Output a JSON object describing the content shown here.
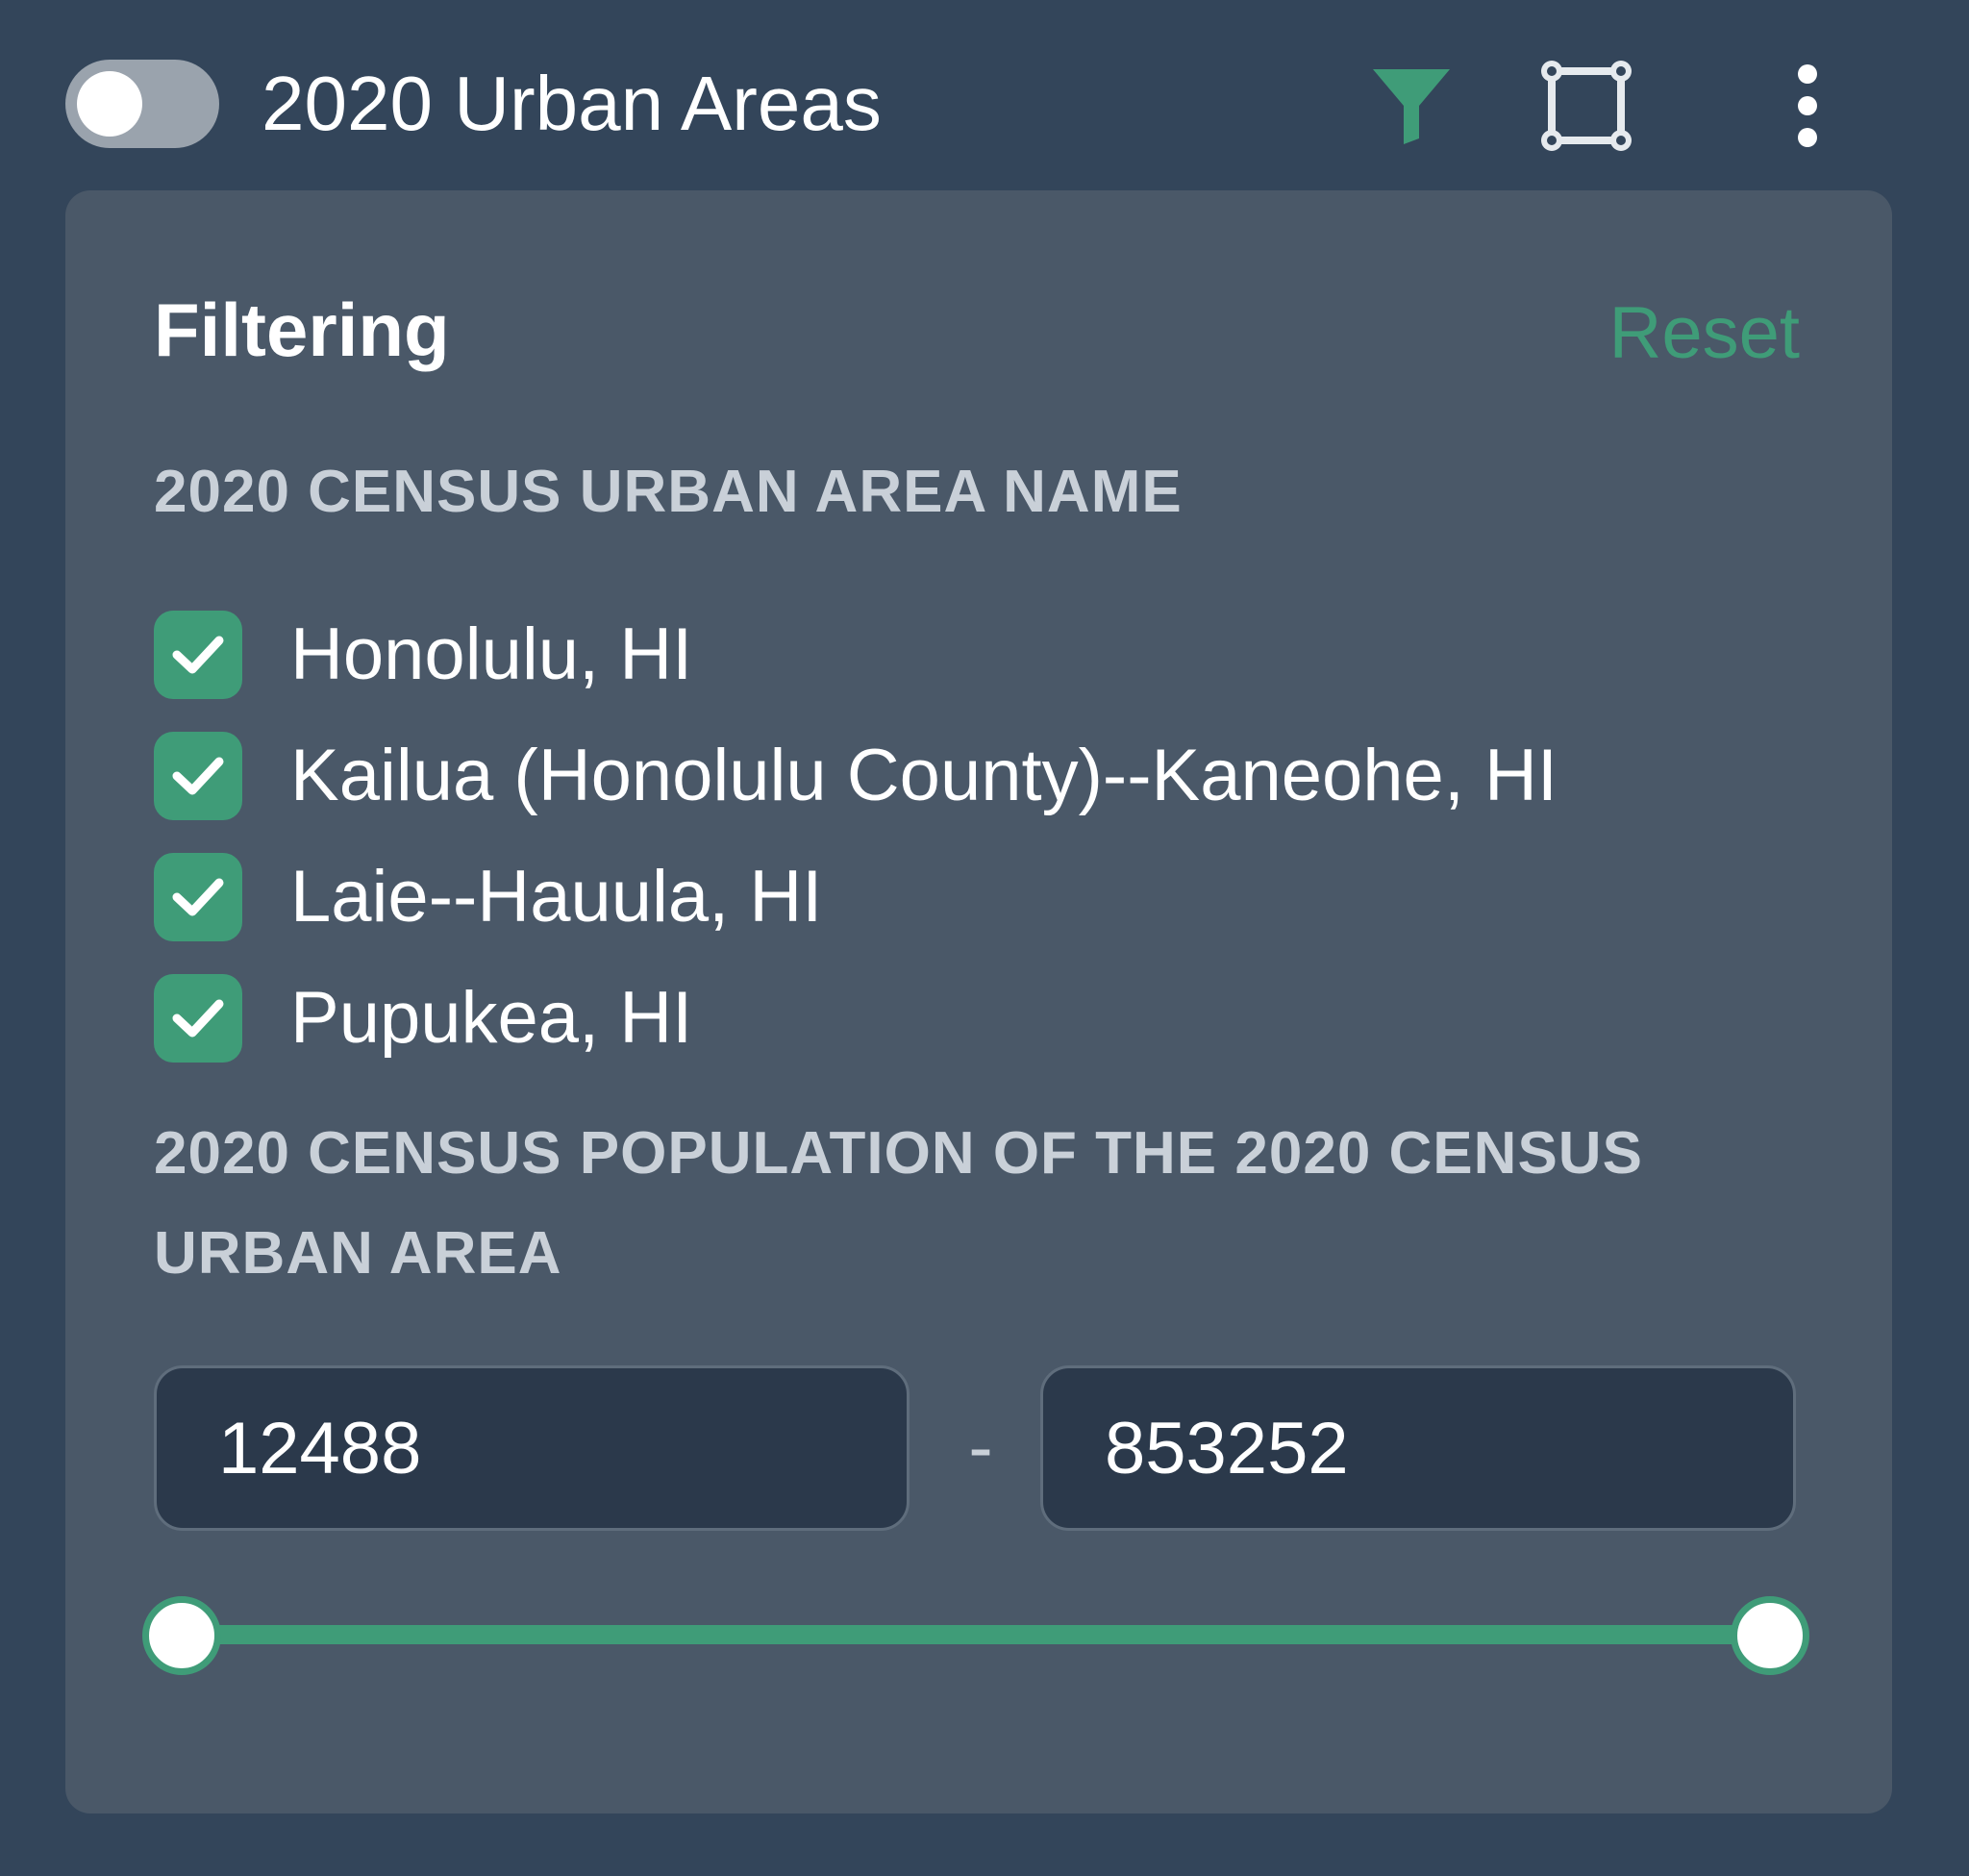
{
  "layer": {
    "title": "2020 Urban Areas",
    "visible": false,
    "icons": {
      "filter": "filter-icon",
      "frame": "frame-select-icon",
      "more": "more-vertical-icon"
    }
  },
  "filtering": {
    "title": "Filtering",
    "reset_label": "Reset",
    "name_section": {
      "label": "2020 CENSUS URBAN AREA NAME",
      "options": [
        {
          "label": "Honolulu, HI",
          "checked": true
        },
        {
          "label": "Kailua (Honolulu County)--Kaneohe, HI",
          "checked": true
        },
        {
          "label": "Laie--Hauula, HI",
          "checked": true
        },
        {
          "label": "Pupukea, HI",
          "checked": true
        }
      ]
    },
    "population_section": {
      "label": "2020 CENSUS POPULATION OF THE 2020 CENSUS URBAN AREA",
      "min_value": "12488",
      "max_value": "853252",
      "separator": "-",
      "slider": {
        "low_fraction": 0,
        "high_fraction": 1
      }
    }
  },
  "colors": {
    "accent": "#3f9c78",
    "background": "#33455a",
    "panel": "#4a5868",
    "input_background": "#2b394b"
  }
}
